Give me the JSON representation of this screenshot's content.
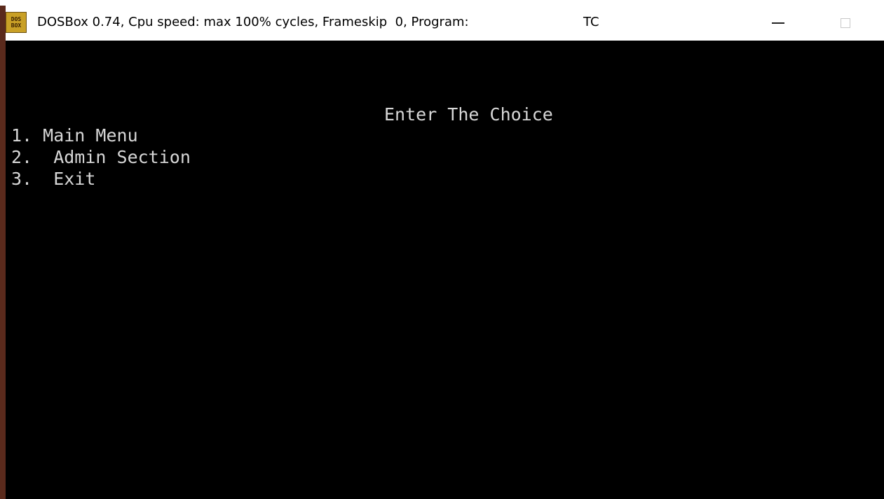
{
  "window": {
    "title": "DOSBox 0.74, Cpu speed: max 100% cycles, Frameskip  0, Program:",
    "program": "TC",
    "icon": "dosbox-icon",
    "icon_text": [
      "DOS",
      "BOX"
    ]
  },
  "screen": {
    "heading": "Enter The Choice",
    "options": [
      "1. Main Menu",
      "2.  Admin Section",
      "3.  Exit"
    ],
    "text_color": "#d7d7d7",
    "background": "#000000"
  }
}
